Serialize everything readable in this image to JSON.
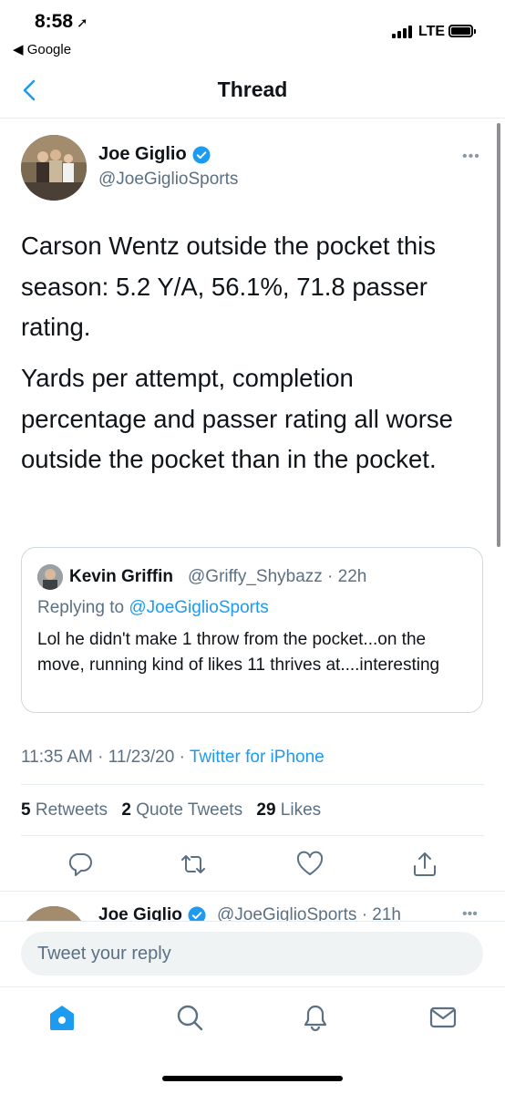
{
  "status_bar": {
    "time": "8:58",
    "back_app": "◀ Google",
    "network": "LTE"
  },
  "nav": {
    "title": "Thread"
  },
  "tweet": {
    "name": "Joe Giglio",
    "handle": "@JoeGiglioSports",
    "paragraphs": [
      "Carson Wentz outside the pocket this season: 5.2 Y/A, 56.1%, 71.8 passer rating.",
      "Yards per attempt, completion percentage and passer rating all worse outside the pocket than in the pocket."
    ],
    "time": "11:35 AM",
    "date": "11/23/20",
    "source": "Twitter for iPhone",
    "retweets_count": "5",
    "retweets_label": "Retweets",
    "quotes_count": "2",
    "quotes_label": "Quote Tweets",
    "likes_count": "29",
    "likes_label": "Likes"
  },
  "quote": {
    "name": "Kevin Griffin",
    "handle_time": "@Griffy_Shybazz · 22h",
    "replying_prefix": "Replying to",
    "replying_to": "@JoeGiglioSports",
    "text": "Lol he didn't make 1 throw from the pocket...on the move, running kind of likes 11 thrives at....interesting"
  },
  "next_tweet": {
    "name": "Joe Giglio",
    "handle_time": "@JoeGiglioSports · 21h"
  },
  "composer": {
    "placeholder": "Tweet your reply"
  },
  "icons": {
    "back": "chevron-left-icon",
    "verified": "verified-badge-icon",
    "more": "more-icon",
    "reply": "reply-icon",
    "retweet": "retweet-icon",
    "like": "heart-icon",
    "share": "share-icon",
    "home": "home-icon",
    "search": "search-icon",
    "notifications": "bell-icon",
    "messages": "mail-icon"
  },
  "colors": {
    "accent": "#1d9bf0",
    "secondary_text": "#5b7083",
    "divider": "#e6ecf0"
  }
}
